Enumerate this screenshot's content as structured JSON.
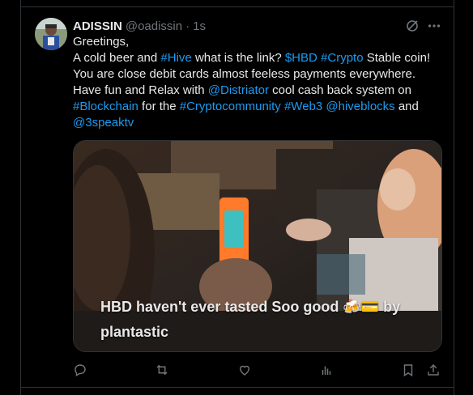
{
  "tweet": {
    "author_name": "ADISSIN",
    "author_handle": "@oadissin",
    "separator": "·",
    "timestamp": "1s",
    "text_parts": [
      {
        "t": "Greetings,",
        "link": false,
        "br": true
      },
      {
        "t": "A cold beer and ",
        "link": false
      },
      {
        "t": "#Hive",
        "link": true
      },
      {
        "t": " what is the link? ",
        "link": false
      },
      {
        "t": "$HBD",
        "link": true
      },
      {
        "t": " ",
        "link": false
      },
      {
        "t": "#Crypto",
        "link": true
      },
      {
        "t": " Stable coin! You are close debit cards almost feeless payments everywhere. Have fun and Relax with ",
        "link": false
      },
      {
        "t": "@Distriator",
        "link": true
      },
      {
        "t": " cool cash back system on ",
        "link": false
      },
      {
        "t": "#Blockchain",
        "link": true
      },
      {
        "t": " for the ",
        "link": false
      },
      {
        "t": "#Cryptocommunity",
        "link": true
      },
      {
        "t": " ",
        "link": false
      },
      {
        "t": "#Web3",
        "link": true
      },
      {
        "t": " ",
        "link": false
      },
      {
        "t": "@hiveblocks",
        "link": true
      },
      {
        "t": " and ",
        "link": false
      },
      {
        "t": "@3speaktv",
        "link": true
      }
    ],
    "media_caption_line1": "HBD haven't ever tasted Soo good 🍻💳 by",
    "media_caption_line2": "plantastic"
  },
  "icons": {
    "grok": "grok-icon",
    "more": "more-icon",
    "reply": "reply-icon",
    "retweet": "retweet-icon",
    "like": "like-icon",
    "views": "views-icon",
    "bookmark": "bookmark-icon",
    "share": "share-icon"
  },
  "colors": {
    "background": "#000000",
    "text": "#e7e9ea",
    "secondary": "#71767b",
    "link": "#1d9bf0",
    "border": "#2f3336"
  }
}
